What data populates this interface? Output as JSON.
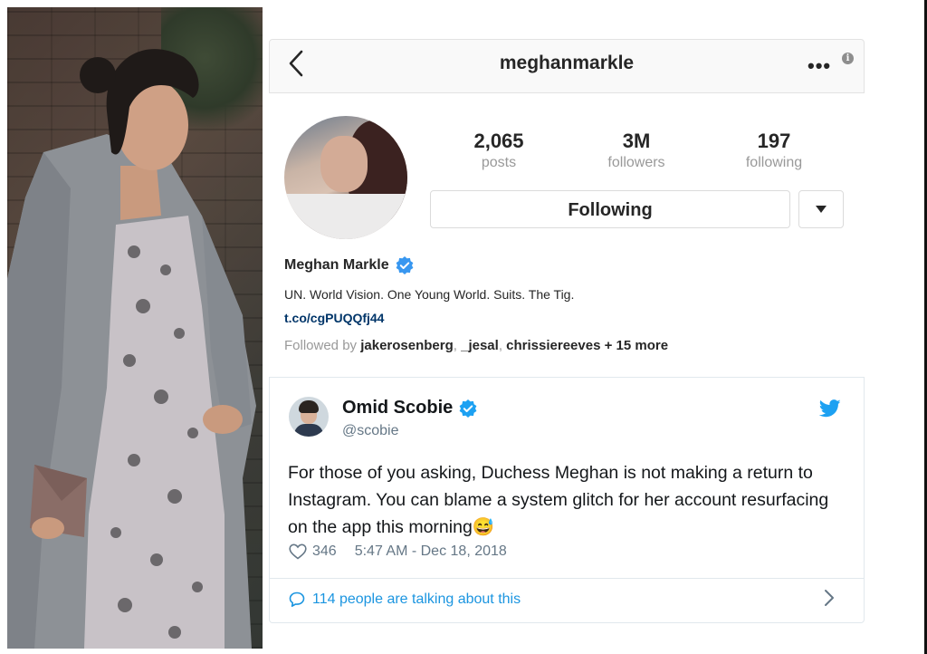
{
  "instagram": {
    "username": "meghanmarkle",
    "stats": [
      {
        "value": "2,065",
        "label": "posts"
      },
      {
        "value": "3M",
        "label": "followers"
      },
      {
        "value": "197",
        "label": "following"
      }
    ],
    "follow_button_label": "Following",
    "display_name": "Meghan Markle",
    "bio": "UN. World Vision. One Young World. Suits. The Tig.",
    "link": "t.co/cgPUQQfj44",
    "followed_by_prefix": "Followed by",
    "followed_by_users": [
      "jakerosenberg",
      "_jesal",
      "chrissiereeves"
    ],
    "followed_by_more": "+ 15 more"
  },
  "tweet": {
    "author_name": "Omid Scobie",
    "author_handle": "@scobie",
    "text": "For those of you asking, Duchess Meghan is not making a return to Instagram. You can blame a system glitch for her account resurfacing on the app this morning",
    "emoji": "😅",
    "likes": "346",
    "timestamp": "5:47 AM - Dec 18, 2018",
    "talking_label": "114 people are talking about this"
  },
  "colors": {
    "verified_blue": "#3897f0",
    "twitter_blue": "#1da1f2",
    "link_blue": "#003569"
  },
  "icons": {
    "back": "chevron-left-icon",
    "more": "ellipsis-icon",
    "info": "info-icon",
    "dropdown": "caret-down-icon",
    "verified": "verified-badge-icon",
    "twitter": "twitter-bird-icon",
    "like": "heart-outline-icon",
    "reply": "speech-bubble-icon",
    "chevron_right": "chevron-right-icon"
  }
}
